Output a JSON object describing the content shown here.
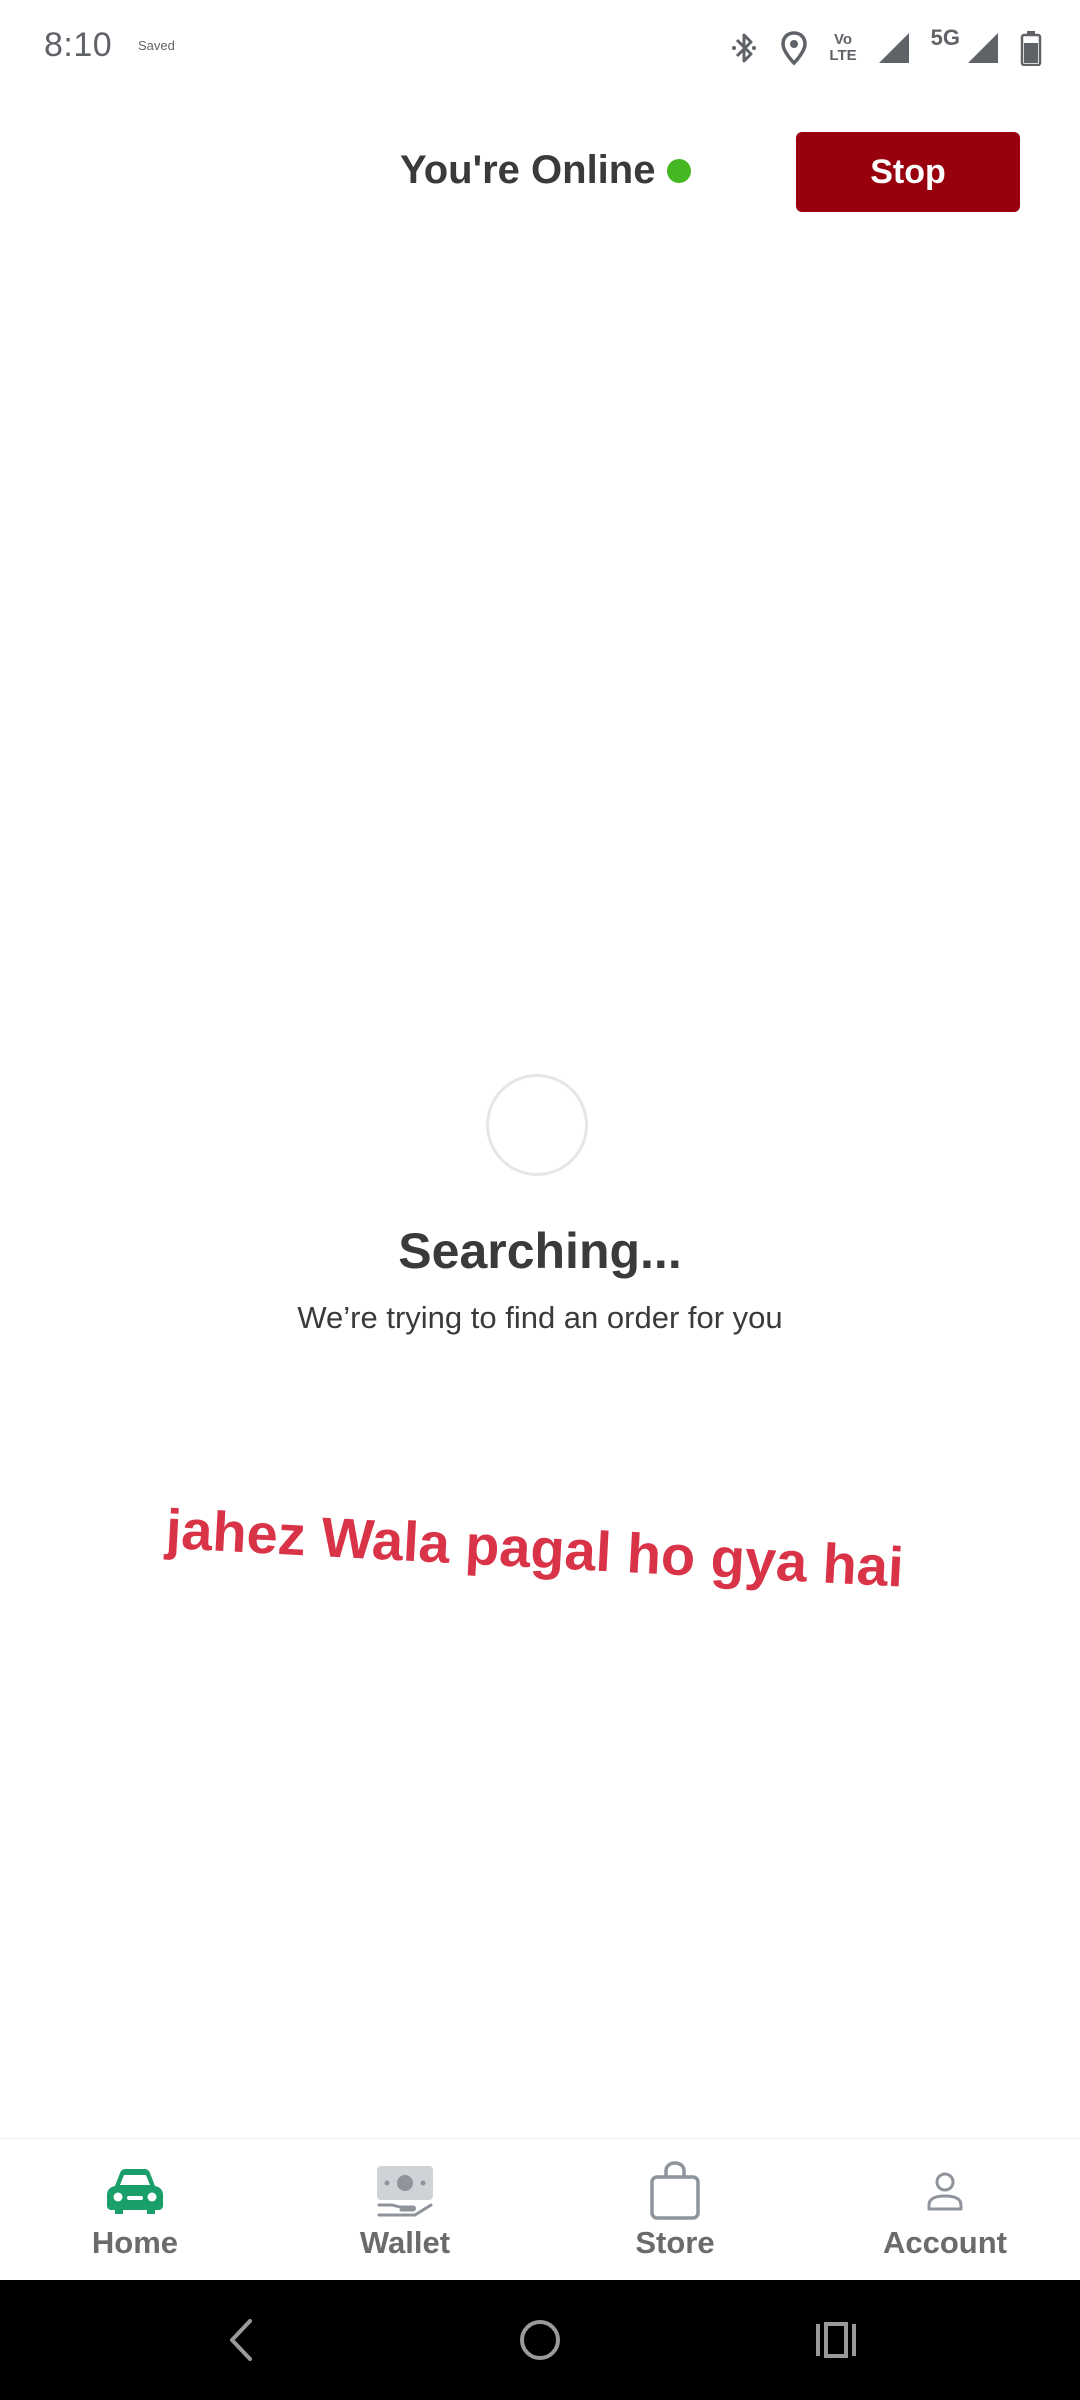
{
  "status_bar": {
    "time": "8:10",
    "note": "Saved",
    "network_label": "5G",
    "volte_top": "Vo",
    "volte_bottom": "LTE",
    "icons": [
      "bluetooth-icon",
      "location-icon",
      "volte-icon",
      "signal-icon",
      "signal-icon",
      "battery-icon"
    ]
  },
  "header": {
    "status_text": "You're Online",
    "status_color": "#44b722",
    "stop_label": "Stop",
    "stop_color": "#98000d"
  },
  "searching": {
    "title": "Searching...",
    "subtitle": "We’re trying to find an order for you"
  },
  "overlay": {
    "text": "jahez  Wala pagal ho gya hai",
    "color": "#d93348"
  },
  "bottom_nav": {
    "items": [
      {
        "label": "Home",
        "icon": "car-icon",
        "active": true,
        "color": "#1a9e6a"
      },
      {
        "label": "Wallet",
        "icon": "wallet-icon",
        "active": false
      },
      {
        "label": "Store",
        "icon": "bag-icon",
        "active": false
      },
      {
        "label": "Account",
        "icon": "person-icon",
        "active": false
      }
    ]
  },
  "system_nav": {
    "icons": [
      "back-icon",
      "home-circle-icon",
      "recents-icon"
    ]
  }
}
